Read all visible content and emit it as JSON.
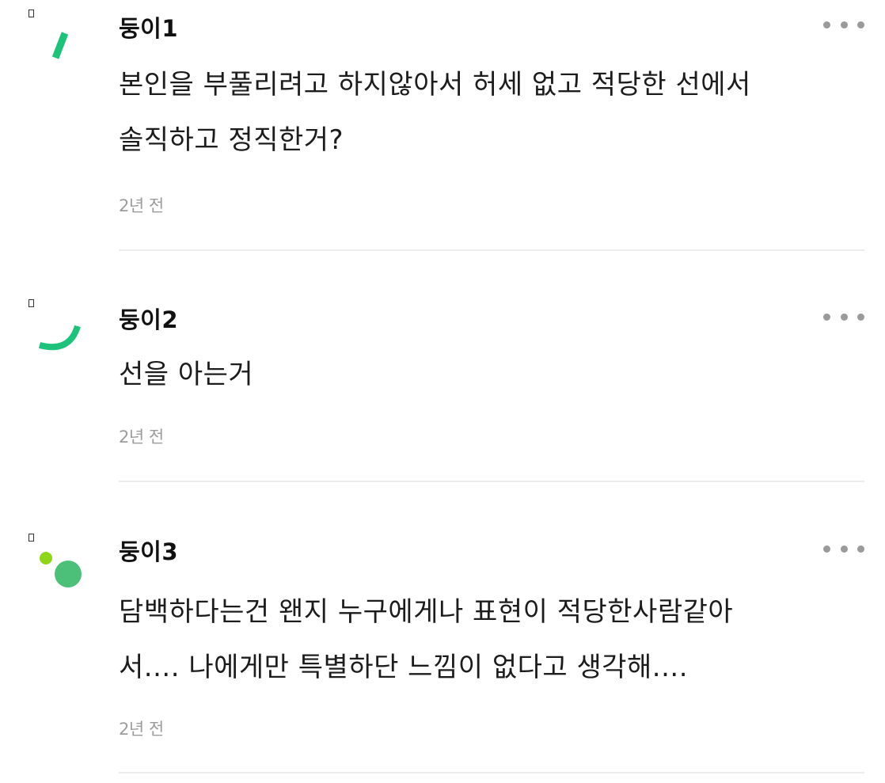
{
  "comments": [
    {
      "author": "둥이1",
      "avatar_icon": "green-slash-avatar-icon",
      "body_lines": [
        "본인을 부풀리려고 하지않아서 허세 없고 적당한 선에서",
        "솔직하고 정직한거?"
      ],
      "time": "2년 전"
    },
    {
      "author": "둥이2",
      "avatar_icon": "green-arc-avatar-icon",
      "body_lines": [
        "선을 아는거"
      ],
      "time": "2년 전"
    },
    {
      "author": "둥이3",
      "avatar_icon": "green-dots-avatar-icon",
      "body_lines": [
        "담백하다는건 왠지 누구에게나 표현이 적당한사람같아",
        "서.... 나에게만 특별하단 느낌이 없다고 생각해...."
      ],
      "time": "2년 전"
    }
  ],
  "more_icon": "more-horizontal-icon",
  "colors": {
    "accent_green": "#1fc27a",
    "accent_lime": "#8fd61a",
    "avatar_circle": "#4cbf78",
    "meta_gray": "#9c9c9c",
    "divider": "#ececec"
  }
}
